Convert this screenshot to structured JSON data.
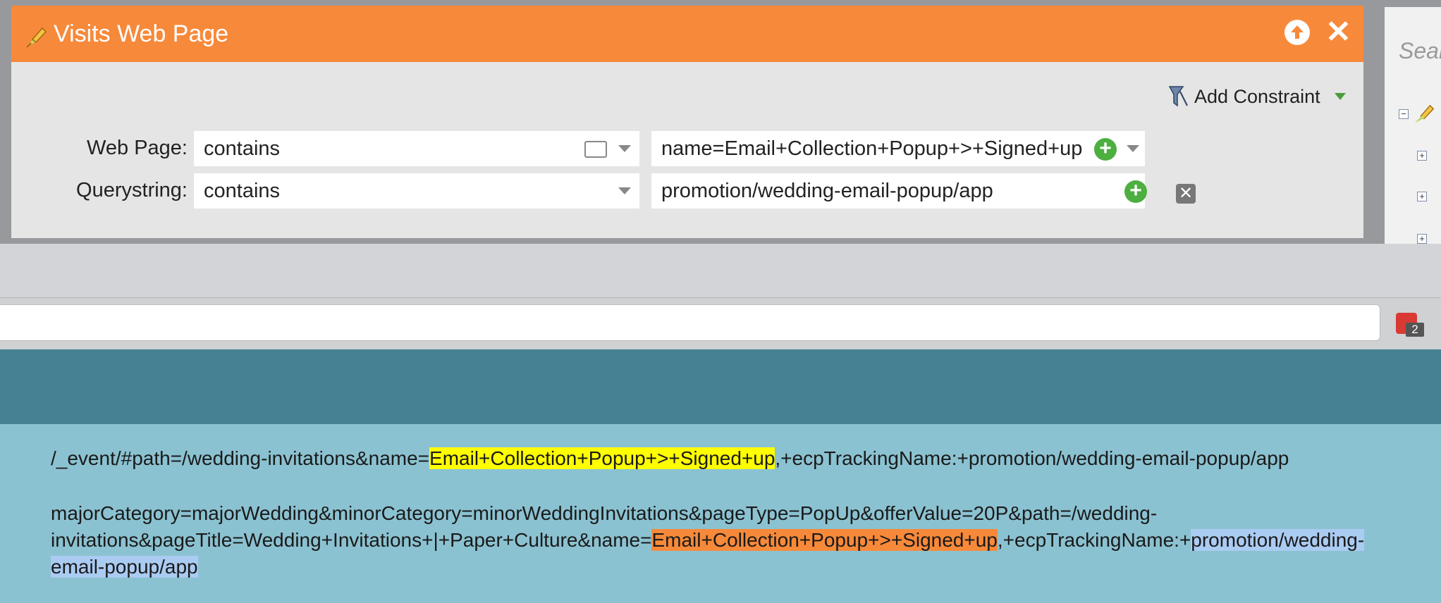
{
  "dialog": {
    "title": "Visits Web Page",
    "add_constraint_label": "Add Constraint",
    "rows": [
      {
        "label": "Web Page:",
        "operator": "contains",
        "value": "name=Email+Collection+Popup+>+Signed+up"
      },
      {
        "label": "Querystring:",
        "operator": "contains",
        "value": "promotion/wedding-email-popup/app"
      }
    ]
  },
  "right_panel": {
    "search_placeholder": "Sear"
  },
  "browser": {
    "extension_badge": "2"
  },
  "page": {
    "line1": {
      "before": "/_event/#path=/wedding-invitations&name=",
      "highlight": "Email+Collection+Popup+>+Signed+up",
      "after": ",+ecpTrackingName:+promotion/wedding-email-popup/app"
    },
    "line2": {
      "text": "majorCategory=majorWedding&minorCategory=minorWeddingInvitations&pageType=PopUp&offerValue=20P&path=/wedding-"
    },
    "line3": {
      "before": "invitations&pageTitle=Wedding+Invitations+|+Paper+Culture&name=",
      "highlight": "Email+Collection+Popup+>+Signed+up",
      "middle": ",+ecpTrackingName:+",
      "highlight2": "promotion/wedding-"
    },
    "line4": {
      "highlight": "email-popup/app"
    }
  },
  "colors": {
    "header_orange": "#f7893a",
    "highlight_yellow": "#ffff00",
    "highlight_orange": "#f7893a",
    "highlight_blue": "#aacbf2",
    "teal_header": "#468193",
    "page_bg": "#8bc2d1"
  },
  "icons": [
    "trigger-icon",
    "arrow-up-circle-icon",
    "close-icon",
    "filter-icon",
    "card-icon",
    "chevron-down-icon",
    "add-circle-icon",
    "remove-icon",
    "tree-collapse-icon",
    "tree-expand-icon",
    "extension-icon"
  ]
}
